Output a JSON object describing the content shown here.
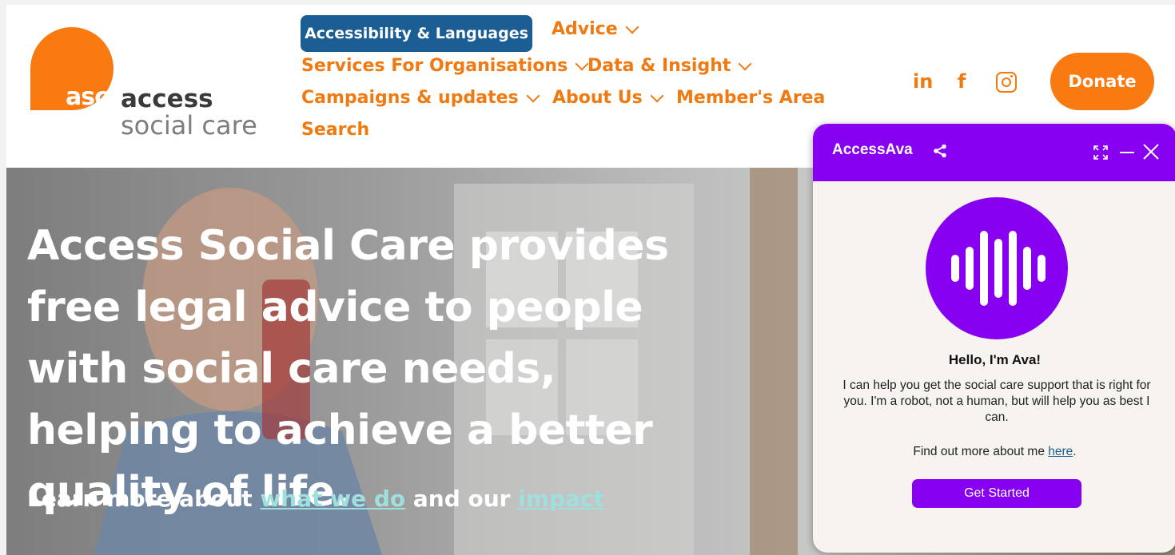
{
  "logo": {
    "mark": "asc",
    "line1": "access",
    "line2": "social care"
  },
  "nav": {
    "accessibility_label": "Accessibility & Languages",
    "advice": "Advice",
    "services": "Services For Organisations",
    "data": "Data & Insight",
    "campaigns": "Campaigns & updates",
    "about": "About Us",
    "members": "Member's Area",
    "search": "Search"
  },
  "social": {
    "linkedin": "in",
    "facebook": "f",
    "instagram_icon": "instagram-icon"
  },
  "donate_label": "Donate",
  "hero": {
    "title": "Access Social Care provides free legal advice to people with social care needs, helping to achieve a better quality of life.",
    "sub_prefix": "Learn more about ",
    "link_what": "what we do",
    "sub_middle": " and our ",
    "link_impact": "impact"
  },
  "chat": {
    "title": "AccessAva",
    "hello": "Hello, I'm Ava!",
    "description": "I can help you get the social care support that is right for you. I'm a robot, not a human, but will help you as best I can.",
    "more_prefix": "Find out more about me ",
    "more_link": "here",
    "more_suffix": ".",
    "start_label": "Get Started"
  },
  "colors": {
    "orange": "#f97a10",
    "blue": "#1b5e93",
    "purple": "#8700f0",
    "teal_link": "#9fe0df"
  }
}
